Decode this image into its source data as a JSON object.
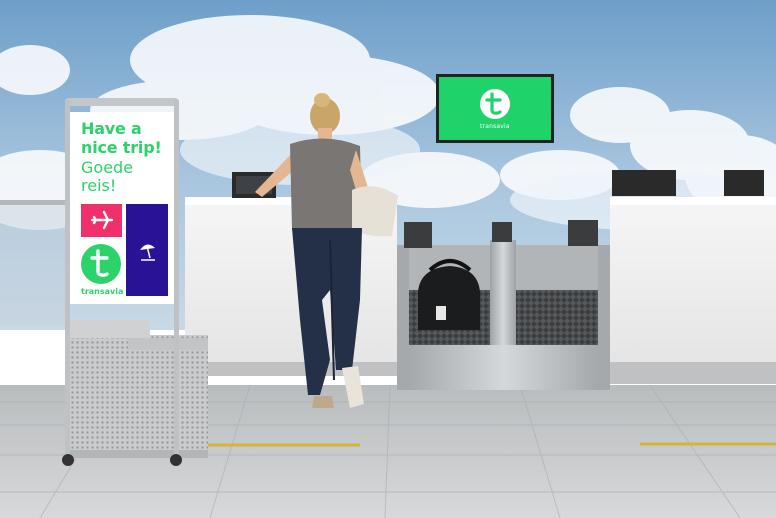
{
  "sign": {
    "line1": "Have a",
    "line2": "nice trip!",
    "line3": "Goede",
    "line4": "reis!",
    "brand": "transavia",
    "colors": {
      "green": "#2bd36a",
      "pink": "#f0306a",
      "purple": "#2a1296"
    },
    "icons": [
      "airplane-icon",
      "beach-umbrella-icon",
      "transavia-t-logo"
    ]
  },
  "tv": {
    "brand": "transavia",
    "color": "#1fd26a"
  }
}
